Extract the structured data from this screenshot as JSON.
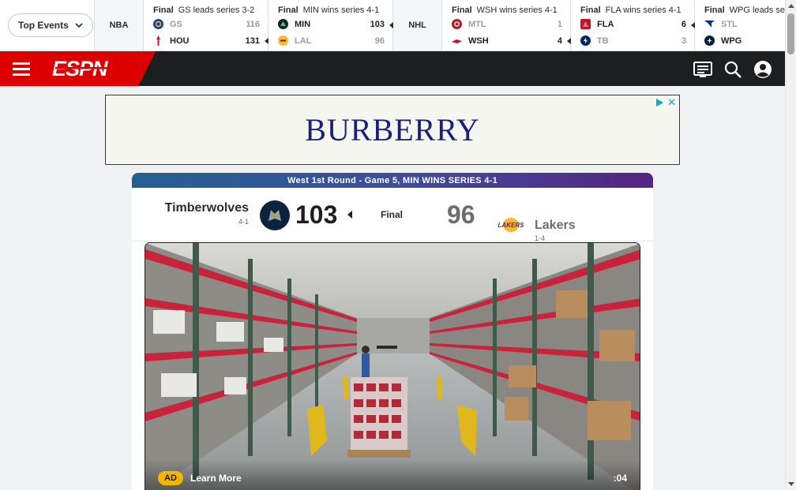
{
  "scorestrip": {
    "events_button": "Top Events",
    "leagues": {
      "nba": "NBA",
      "nhl": "NHL"
    },
    "games": [
      {
        "status": "Final",
        "note": "GS leads series 3-2",
        "teams": [
          {
            "abbr": "GS",
            "score": "116",
            "color": "#1d428a"
          },
          {
            "abbr": "HOU",
            "score": "131",
            "color": "#ce1141"
          }
        ]
      },
      {
        "status": "Final",
        "note": "MIN wins series 4-1",
        "teams": [
          {
            "abbr": "MIN",
            "score": "103",
            "color": "#0c2340"
          },
          {
            "abbr": "LAL",
            "score": "96",
            "color": "#fdb927"
          }
        ]
      },
      {
        "status": "Final",
        "note": "WSH wins series 4-1",
        "teams": [
          {
            "abbr": "MTL",
            "score": "1",
            "color": "#af1e2d"
          },
          {
            "abbr": "WSH",
            "score": "4",
            "color": "#c8102e"
          }
        ]
      },
      {
        "status": "Final",
        "note": "FLA wins series 4-1",
        "teams": [
          {
            "abbr": "FLA",
            "score": "6",
            "color": "#c8102e"
          },
          {
            "abbr": "TB",
            "score": "3",
            "color": "#002868"
          }
        ]
      },
      {
        "status": "Final",
        "note": "WPG leads se",
        "teams": [
          {
            "abbr": "STL",
            "score": "",
            "color": "#002f87"
          },
          {
            "abbr": "WPG",
            "score": "",
            "color": "#041e42"
          }
        ]
      }
    ]
  },
  "header": {
    "logo_text": "ESPN",
    "icons": [
      "scores-icon",
      "search-icon",
      "profile-icon"
    ]
  },
  "ad": {
    "brand": "BURBERRY"
  },
  "game": {
    "round": "West 1st Round - Game 5, MIN WINS SERIES 4-1",
    "home": {
      "name": "Timberwolves",
      "record": "4-1",
      "score": "103"
    },
    "status": "Final",
    "away": {
      "name": "Lakers",
      "record": "1-4",
      "score": "96"
    }
  },
  "video": {
    "ad_badge": "AD",
    "learn_more": "Learn More",
    "time": ":04"
  }
}
